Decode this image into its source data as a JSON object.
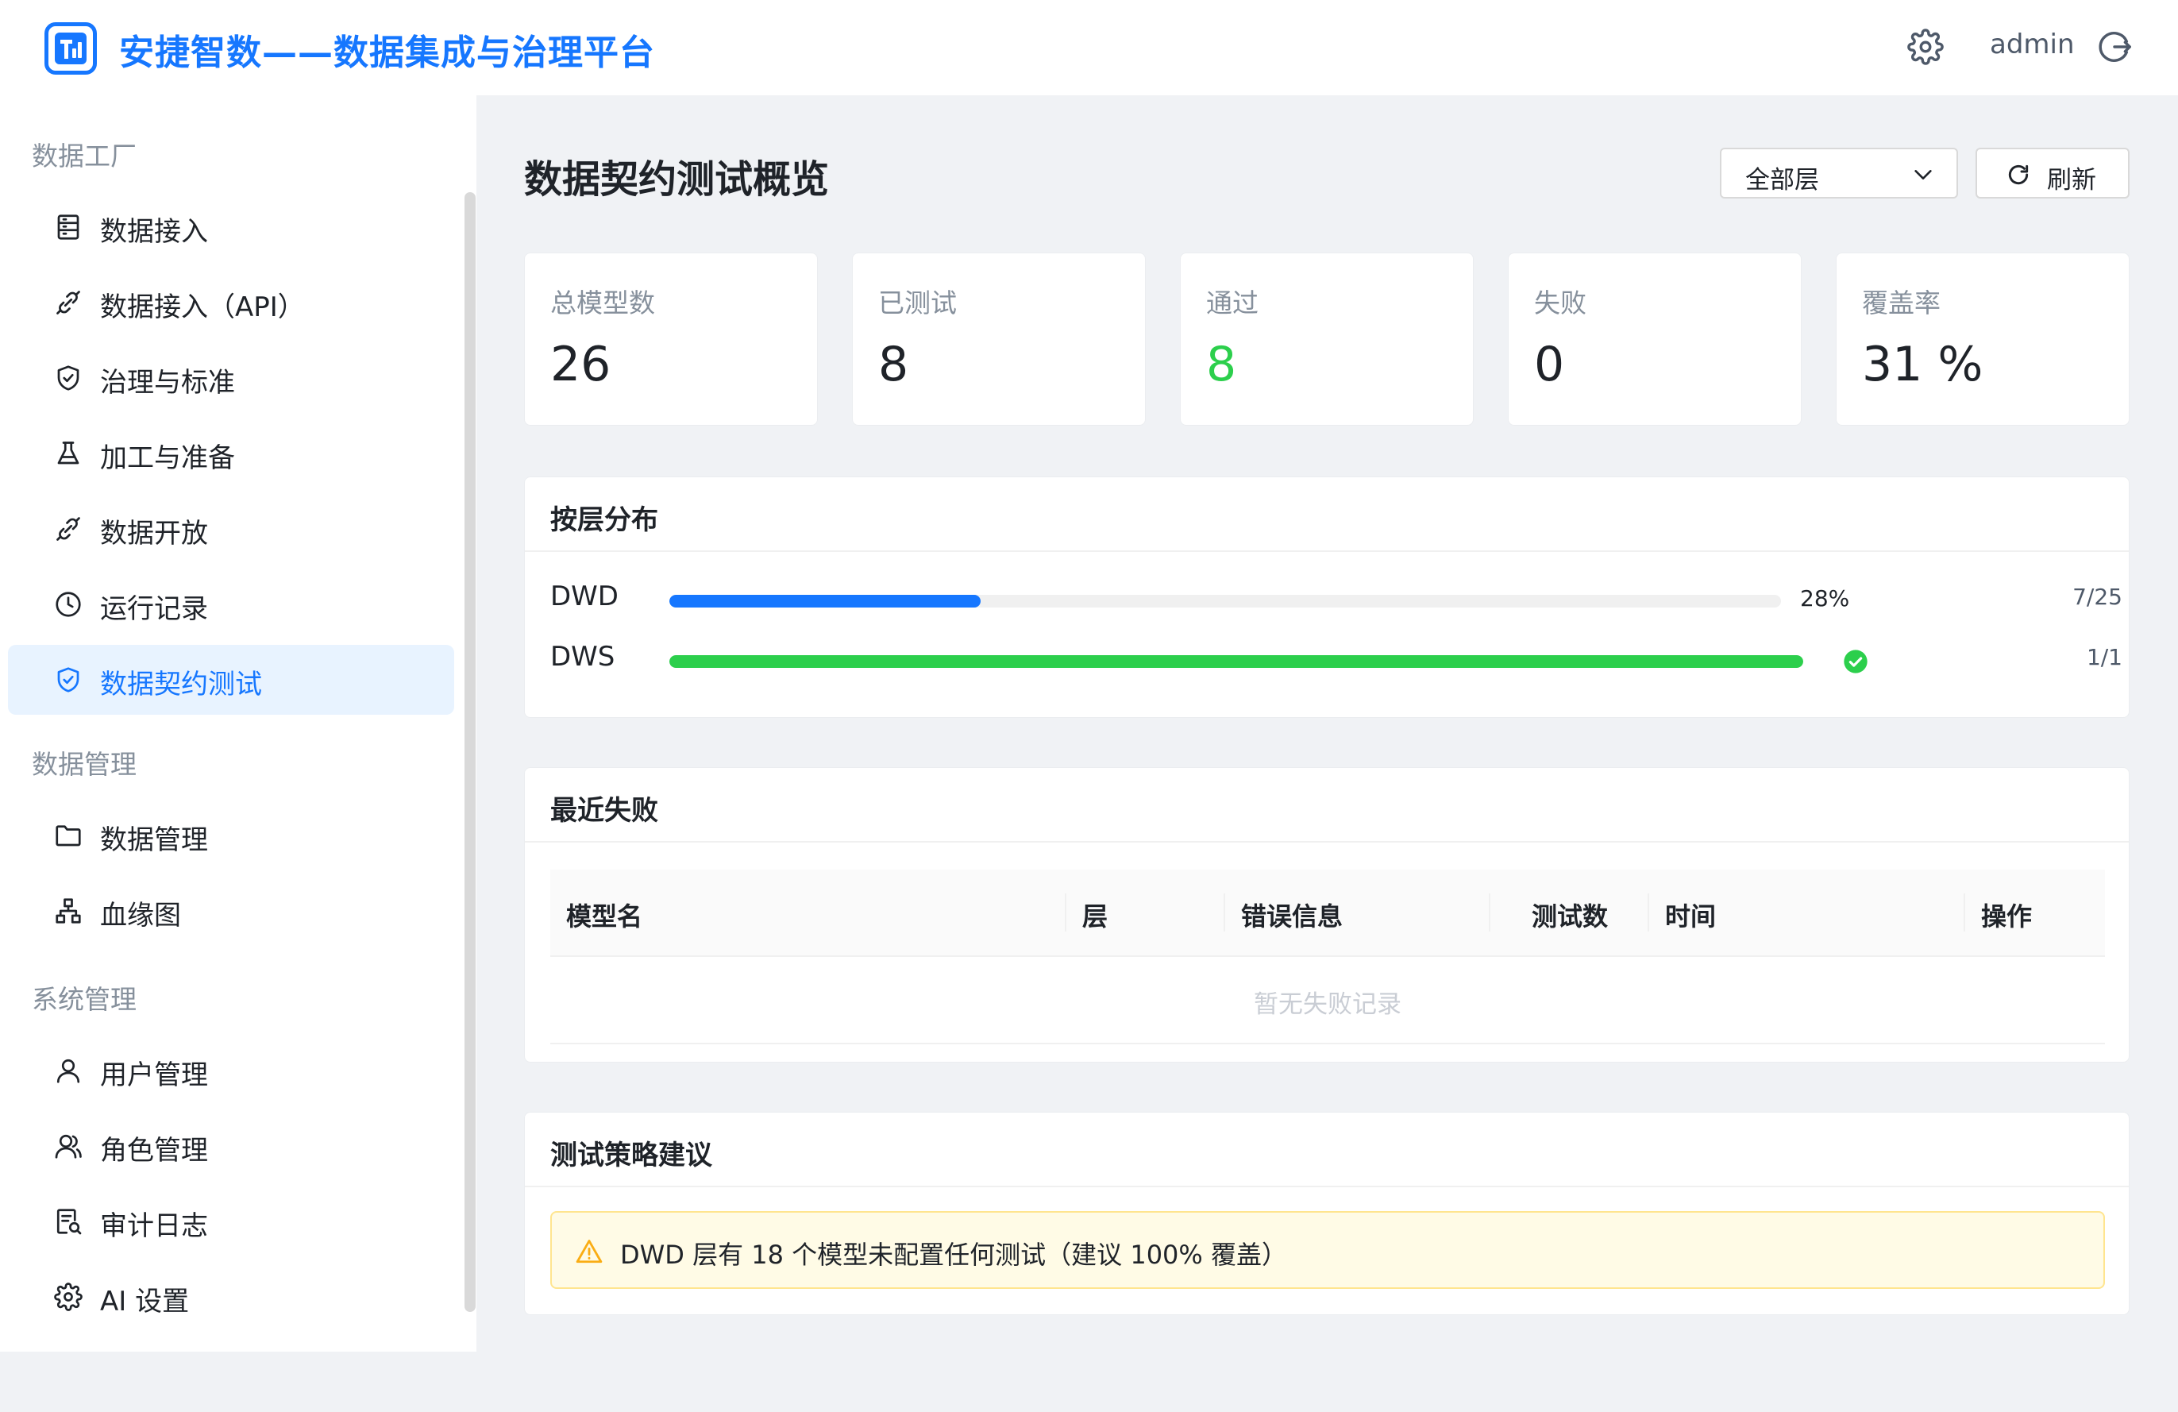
{
  "header": {
    "title": "安捷智数——数据集成与治理平台",
    "user": "admin"
  },
  "sidebar": {
    "groups": [
      {
        "label": "数据工厂",
        "items": [
          {
            "label": "数据接入",
            "icon": "database-icon"
          },
          {
            "label": "数据接入（API）",
            "icon": "link-icon"
          },
          {
            "label": "治理与标准",
            "icon": "shield-icon"
          },
          {
            "label": "加工与准备",
            "icon": "flask-icon"
          },
          {
            "label": "数据开放",
            "icon": "link-icon"
          },
          {
            "label": "运行记录",
            "icon": "clock-icon"
          },
          {
            "label": "数据契约测试",
            "icon": "shield-icon",
            "active": true
          }
        ]
      },
      {
        "label": "数据管理",
        "items": [
          {
            "label": "数据管理",
            "icon": "folder-icon"
          },
          {
            "label": "血缘图",
            "icon": "lineage-icon"
          }
        ]
      },
      {
        "label": "系统管理",
        "items": [
          {
            "label": "用户管理",
            "icon": "user-icon"
          },
          {
            "label": "角色管理",
            "icon": "users-icon"
          },
          {
            "label": "审计日志",
            "icon": "audit-icon"
          },
          {
            "label": "AI 设置",
            "icon": "gear-icon"
          }
        ]
      }
    ]
  },
  "main": {
    "title": "数据契约测试概览",
    "layer_select": {
      "value": "全部层"
    },
    "refresh_label": "刷新",
    "stats": [
      {
        "label": "总模型数",
        "value": "26"
      },
      {
        "label": "已测试",
        "value": "8"
      },
      {
        "label": "通过",
        "value": "8"
      },
      {
        "label": "失败",
        "value": "0"
      },
      {
        "label": "覆盖率",
        "value": "31 %"
      }
    ],
    "distribution": {
      "title": "按层分布",
      "layers": [
        {
          "name": "DWD",
          "progress": 0.28,
          "pct_label": "28%",
          "count": "7/25",
          "color": "#1677ff"
        },
        {
          "name": "DWS",
          "progress": 1.0,
          "pct_label": "",
          "count": "1/1",
          "color": "#2ccf4c"
        }
      ]
    },
    "failures": {
      "title": "最近失败",
      "columns": [
        "模型名",
        "层",
        "错误信息",
        "测试数",
        "时间",
        "操作"
      ],
      "empty_text": "暂无失败记录"
    },
    "strategy": {
      "title": "测试策略建议",
      "alert": "DWD 层有 18 个模型未配置任何测试（建议 100% 覆盖）"
    }
  }
}
